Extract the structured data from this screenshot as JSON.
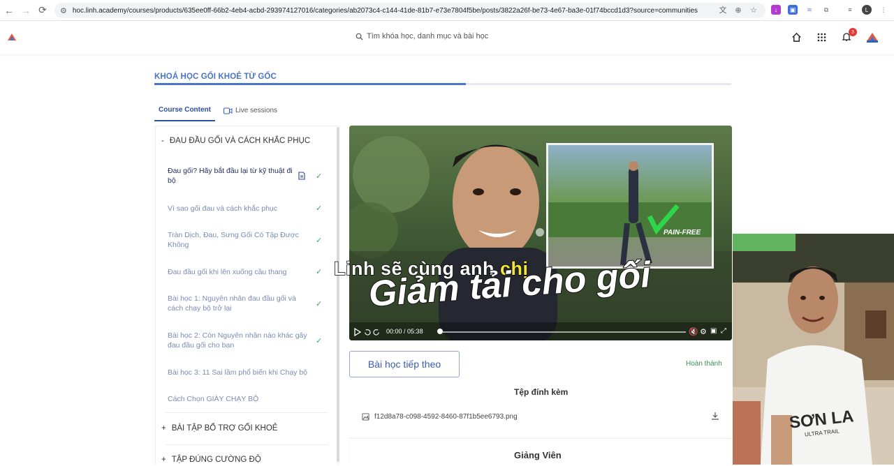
{
  "browser": {
    "url": "hoc.linh.academy/courses/products/635ee0ff-66b2-4eb4-acbd-293974127016/categories/ab2073c4-c144-41de-81b7-e73e7804f5be/posts/3822a26f-be73-4e67-ba3e-01f74bccd1d3?source=communities",
    "profile_initial": "L"
  },
  "header": {
    "search_placeholder": "Tìm khóa học, danh mục và bài học",
    "notification_count": "3"
  },
  "course": {
    "title": "KHOÁ HỌC GỐI KHOẺ TỪ GỐC",
    "progress": 0.54
  },
  "tabs": [
    {
      "label": "Course Content",
      "active": true
    },
    {
      "label": "Live sessions",
      "active": false
    }
  ],
  "sidebar": {
    "sections": [
      {
        "toggle": "-",
        "title": "ĐAU ĐẦU GỐI VÀ CÁCH KHẮC PHỤC"
      },
      {
        "toggle": "+",
        "title": "BÀI TẬP BỔ TRỢ GỐI KHOẺ"
      },
      {
        "toggle": "+",
        "title": "TẬP ĐÚNG CƯỜNG ĐỘ"
      }
    ],
    "lessons": [
      {
        "title": "Đau gối? Hãy bắt đầu lại từ kỹ thuật đi bộ",
        "done": true,
        "current": true
      },
      {
        "title": "Vì sao gối đau và cách khắc phục",
        "done": true
      },
      {
        "title": "Tràn Dịch, Đau, Sưng Gối Có Tập Được Không",
        "done": true
      },
      {
        "title": "Đau đầu gối khi lên xuống cầu thang",
        "done": true
      },
      {
        "title": "Bài học 1: Nguyên nhân đau đầu gối và cách chạy bộ trở lại",
        "done": true
      },
      {
        "title": "Bài học 2: Còn Nguyên nhân nào khác gây đau đầu gối cho bạn",
        "done": true
      },
      {
        "title": "Bài học 3: 11 Sai lầm phổ biến khi Chạy bộ",
        "done": false
      },
      {
        "title": "Cách Chọn GIÀY CHẠY BỘ",
        "done": false
      }
    ]
  },
  "video": {
    "subtitle_part1": "Linh sẽ cùng anh ",
    "subtitle_highlight": "chị",
    "subtitle_line2": "Giảm tải cho gối",
    "badge": "PAIN-FREE",
    "current_time": "00:00",
    "duration": "05:38"
  },
  "lesson_actions": {
    "next_label": "Bài học tiếp theo",
    "status": "Hoàn thành"
  },
  "attachments": {
    "title": "Tệp đính kèm",
    "files": [
      {
        "name": "f12d8a78-c098-4592-8460-87f1b5ee6793.png"
      }
    ]
  },
  "instructor": {
    "title": "Giảng Viên"
  },
  "webcam": {
    "shirt_text": "SƠN LA",
    "shirt_subtext": "ULTRA TRAIL"
  }
}
